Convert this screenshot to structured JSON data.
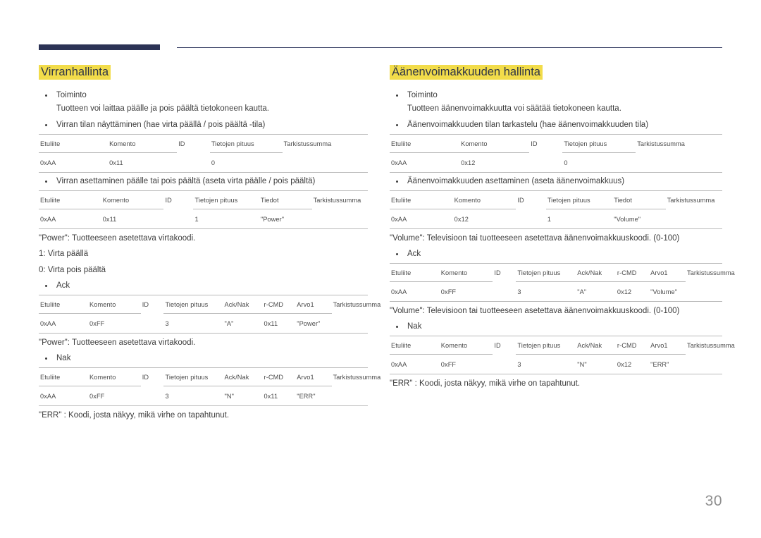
{
  "page": {
    "number": "30",
    "accent_navy": "#2c3355",
    "highlight_yellow": "#f2dc4a",
    "rule_gray": "#b9b9b9"
  },
  "columns": {
    "left": {
      "heading": "Virranhallinta",
      "blocks": {
        "function_label": "Toiminto",
        "function_desc": "Tuotteen voi laittaa päälle ja pois päältä tietokoneen kautta.",
        "view_state_label": "Virran tilan näyttäminen (hae virta päällä / pois päältä -tila)",
        "set_state_label": "Virran asettaminen päälle tai pois päältä (aseta virta päälle / pois päältä)",
        "power_note": "\"Power\": Tuotteeseen asetettava virtakoodi.",
        "power_on": "1: Virta päällä",
        "power_off": "0: Virta pois päältä",
        "ack_label": "Ack",
        "power_note_2": "\"Power\": Tuotteeseen asetettava virtakoodi.",
        "nak_label": "Nak",
        "err_note": "\"ERR\" : Koodi, josta näkyy, mikä virhe on tapahtunut."
      },
      "tables": {
        "view": {
          "headers": [
            "Etuliite",
            "Komento",
            "ID",
            "Tietojen pituus",
            "Tarkistussumma"
          ],
          "row": [
            "0xAA",
            "0x11",
            "",
            "0",
            ""
          ]
        },
        "set": {
          "headers": [
            "Etuliite",
            "Komento",
            "ID",
            "Tietojen pituus",
            "Tiedot",
            "Tarkistussumma"
          ],
          "row": [
            "0xAA",
            "0x11",
            "",
            "1",
            "\"Power\"",
            ""
          ]
        },
        "ack": {
          "headers": [
            "Etuliite",
            "Komento",
            "ID",
            "Tietojen pituus",
            "Ack/Nak",
            "r-CMD",
            "Arvo1",
            "Tarkistussumma"
          ],
          "row": [
            "0xAA",
            "0xFF",
            "",
            "3",
            "\"A\"",
            "0x11",
            "\"Power\"",
            ""
          ]
        },
        "nak": {
          "headers": [
            "Etuliite",
            "Komento",
            "ID",
            "Tietojen pituus",
            "Ack/Nak",
            "r-CMD",
            "Arvo1",
            "Tarkistussumma"
          ],
          "row": [
            "0xAA",
            "0xFF",
            "",
            "3",
            "\"N\"",
            "0x11",
            "\"ERR\"",
            ""
          ]
        }
      }
    },
    "right": {
      "heading": "Äänenvoimakkuuden hallinta",
      "blocks": {
        "function_label": "Toiminto",
        "function_desc": "Tuotteen äänenvoimakkuutta voi säätää tietokoneen kautta.",
        "view_state_label": "Äänenvoimakkuuden tilan tarkastelu (hae äänenvoimakkuuden tila)",
        "set_state_label": "Äänenvoimakkuuden asettaminen (aseta äänenvoimakkuus)",
        "volume_note": "\"Volume\": Televisioon tai tuotteeseen asetettava äänenvoimakkuuskoodi. (0-100)",
        "ack_label": "Ack",
        "volume_note_2": "\"Volume\": Televisioon tai tuotteeseen asetettava äänenvoimakkuuskoodi. (0-100)",
        "nak_label": "Nak",
        "err_note": "\"ERR\" : Koodi, josta näkyy, mikä virhe on tapahtunut."
      },
      "tables": {
        "view": {
          "headers": [
            "Etuliite",
            "Komento",
            "ID",
            "Tietojen pituus",
            "Tarkistussumma"
          ],
          "row": [
            "0xAA",
            "0x12",
            "",
            "0",
            ""
          ]
        },
        "set": {
          "headers": [
            "Etuliite",
            "Komento",
            "ID",
            "Tietojen pituus",
            "Tiedot",
            "Tarkistussumma"
          ],
          "row": [
            "0xAA",
            "0x12",
            "",
            "1",
            "\"Volume\"",
            ""
          ]
        },
        "ack": {
          "headers": [
            "Etuliite",
            "Komento",
            "ID",
            "Tietojen pituus",
            "Ack/Nak",
            "r-CMD",
            "Arvo1",
            "Tarkistussumma"
          ],
          "row": [
            "0xAA",
            "0xFF",
            "",
            "3",
            "\"A\"",
            "0x12",
            "\"Volume\"",
            ""
          ]
        },
        "nak": {
          "headers": [
            "Etuliite",
            "Komento",
            "ID",
            "Tietojen pituus",
            "Ack/Nak",
            "r-CMD",
            "Arvo1",
            "Tarkistussumma"
          ],
          "row": [
            "0xAA",
            "0xFF",
            "",
            "3",
            "\"N\"",
            "0x12",
            "\"ERR\"",
            ""
          ]
        }
      }
    }
  }
}
